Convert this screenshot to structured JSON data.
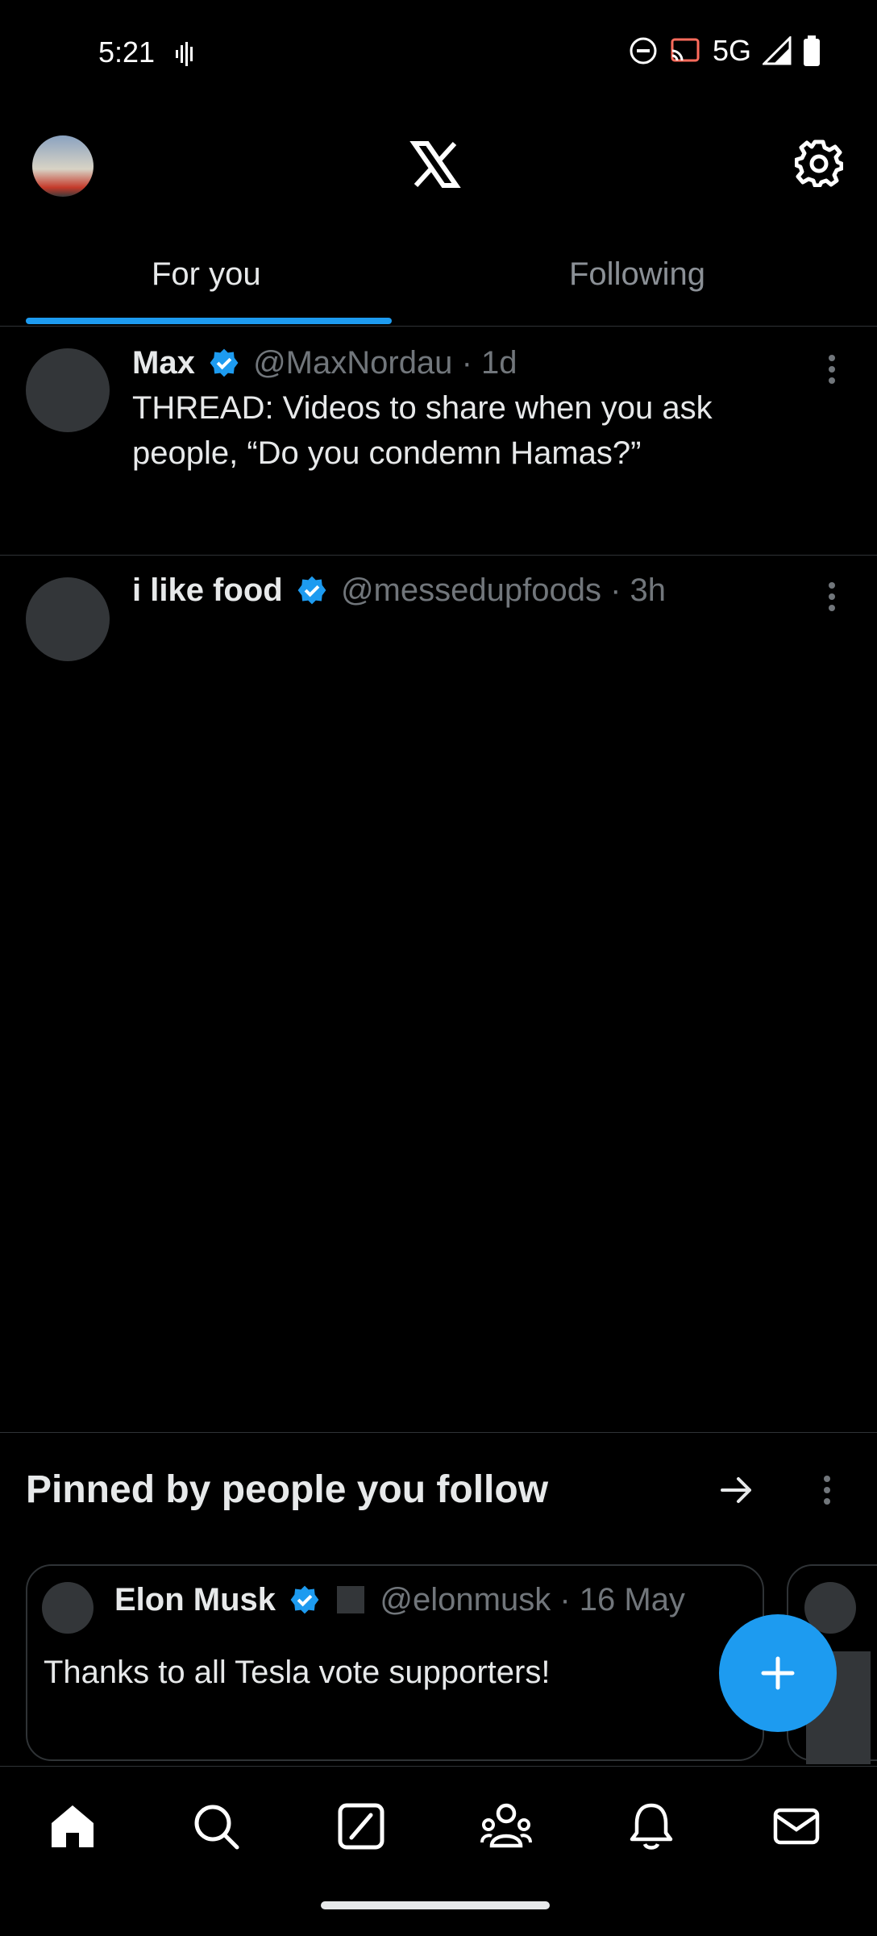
{
  "status": {
    "time": "5:21",
    "network": "5G"
  },
  "tabs": [
    {
      "label": "For you",
      "selected": true
    },
    {
      "label": "Following",
      "selected": false
    }
  ],
  "posts": [
    {
      "name": "Max",
      "handle": "@MaxNordau",
      "time": "· 1d",
      "text": "THREAD: Videos to share when you ask people, “Do you condemn Hamas?”"
    },
    {
      "name": "i like food",
      "handle": "@messedupfoods",
      "time": "· 3h",
      "text": ""
    }
  ],
  "pinned": {
    "title": "Pinned by people you follow",
    "card": {
      "name": "Elon Musk",
      "handle": "@elonmusk",
      "time": "· 16 May",
      "text": "Thanks to all Tesla vote supporters!"
    }
  },
  "colors": {
    "accent": "#1d9bf0",
    "background": "#000000",
    "divider": "#2f3336"
  },
  "icons": [
    "signal-wave-icon",
    "dnd-icon",
    "cast-icon",
    "cell-signal-icon",
    "battery-icon",
    "x-logo",
    "gear-icon",
    "verified-badge-icon",
    "more-options-icon",
    "arrow-right-icon",
    "compose-plus-icon",
    "home-icon",
    "search-icon",
    "grok-icon",
    "communities-icon",
    "notifications-icon",
    "messages-icon"
  ]
}
